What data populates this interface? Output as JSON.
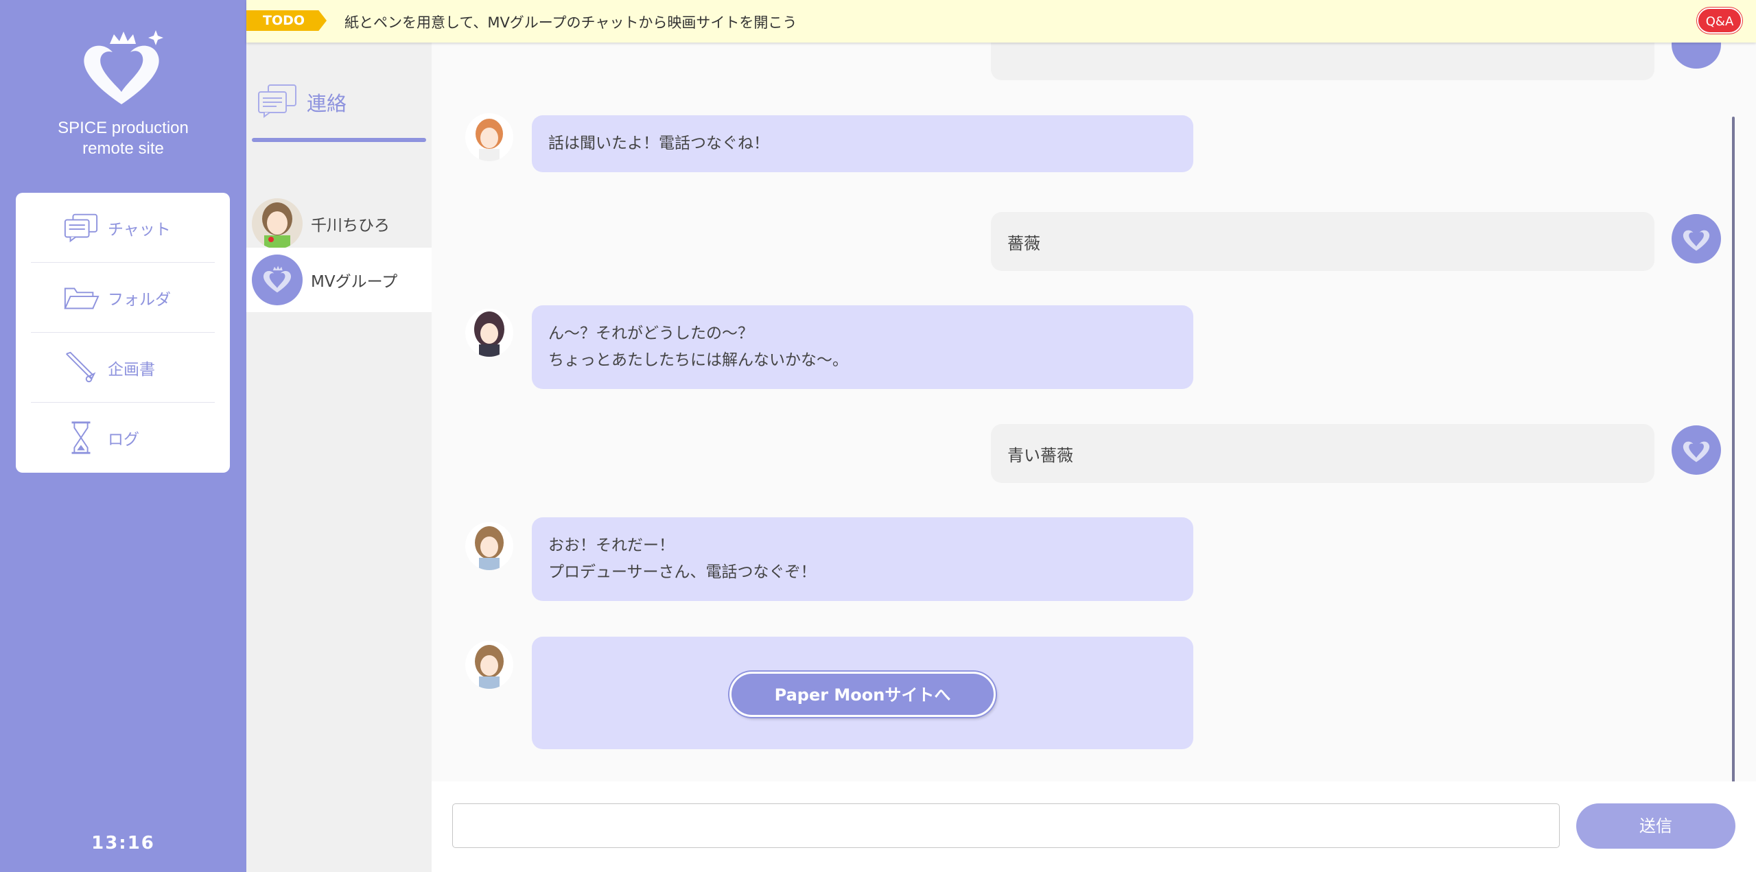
{
  "sidebar": {
    "site_title_line1": "SPICE production",
    "site_title_line2": "remote site",
    "nav": [
      {
        "label": "チャット",
        "icon": "chat-icon"
      },
      {
        "label": "フォルダ",
        "icon": "folder-icon"
      },
      {
        "label": "企画書",
        "icon": "pen-icon"
      },
      {
        "label": "ログ",
        "icon": "hourglass-icon"
      }
    ],
    "clock": "13:16"
  },
  "todo": {
    "badge": "TODO",
    "text": "紙とペンを用意して、MVグループのチャットから映画サイトを開こう",
    "qa_label": "Q&A"
  },
  "contacts": {
    "header": "連絡",
    "items": [
      {
        "name": "千川ちひろ",
        "active": false
      },
      {
        "name": "MVグループ",
        "active": true
      }
    ]
  },
  "chat": {
    "messages": [
      {
        "side": "left",
        "lines": [
          "話は聞いたよ！電話つなぐね！"
        ]
      },
      {
        "side": "right",
        "lines": [
          "薔薇"
        ]
      },
      {
        "side": "left",
        "lines": [
          "ん〜？それがどうしたの〜？",
          "ちょっとあたしたちには解んないかな〜。"
        ]
      },
      {
        "side": "right",
        "lines": [
          "青い薔薇"
        ]
      },
      {
        "side": "left",
        "lines": [
          "おお！それだー！",
          "プロデューサーさん、電話つなぐぞ！"
        ]
      }
    ],
    "link_button": "Paper Moonサイトへ"
  },
  "input": {
    "value": "",
    "placeholder": "",
    "send_label": "送信"
  },
  "colors": {
    "accent": "#8e93de",
    "bubble_left": "#dcdcfc",
    "bubble_right": "#f1f1f1",
    "todo_bg": "#fffed8",
    "todo_badge": "#f5b800",
    "qa": "#e8323a"
  }
}
